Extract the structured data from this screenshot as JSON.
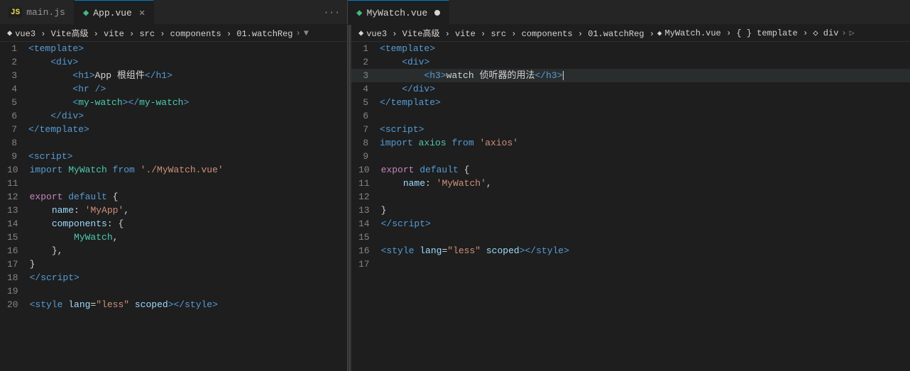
{
  "tabs_left": [
    {
      "id": "main-js",
      "icon": "JS",
      "icon_type": "js",
      "label": "main.js",
      "active": false,
      "modified": false,
      "closable": false
    },
    {
      "id": "app-vue",
      "icon": "V",
      "icon_type": "vue",
      "label": "App.vue",
      "active": true,
      "modified": false,
      "closable": true
    }
  ],
  "tabs_more_left": "···",
  "tabs_right": [
    {
      "id": "mywatch-vue",
      "icon": "V",
      "icon_type": "vue",
      "label": "MyWatch.vue",
      "active": true,
      "modified": true,
      "closable": false
    }
  ],
  "breadcrumb_left": {
    "items": [
      "vue3",
      "Vite高级",
      "vite",
      "src",
      "components",
      "01.watchReg"
    ],
    "icon": "▼"
  },
  "breadcrumb_right": {
    "items": [
      "vue3",
      "Vite高级",
      "vite",
      "src",
      "components",
      "01.watchReg"
    ],
    "file": "MyWatch.vue",
    "sections": [
      "{ } template",
      "◇ div"
    ]
  },
  "code_left": [
    {
      "num": 1,
      "tokens": [
        {
          "t": "<",
          "c": "tag"
        },
        {
          "t": "template",
          "c": "tag-name-html"
        },
        {
          "t": ">",
          "c": "tag"
        }
      ]
    },
    {
      "num": 2,
      "tokens": [
        {
          "t": "    ",
          "c": "plain"
        },
        {
          "t": "<",
          "c": "tag"
        },
        {
          "t": "div",
          "c": "tag-name-html"
        },
        {
          "t": ">",
          "c": "tag"
        }
      ]
    },
    {
      "num": 3,
      "tokens": [
        {
          "t": "        ",
          "c": "plain"
        },
        {
          "t": "<",
          "c": "tag"
        },
        {
          "t": "h1",
          "c": "tag-name-html"
        },
        {
          "t": ">",
          "c": "tag"
        },
        {
          "t": "App 根组件",
          "c": "plain"
        },
        {
          "t": "</",
          "c": "tag"
        },
        {
          "t": "h1",
          "c": "tag-name-html"
        },
        {
          "t": ">",
          "c": "tag"
        }
      ]
    },
    {
      "num": 4,
      "tokens": [
        {
          "t": "        ",
          "c": "plain"
        },
        {
          "t": "<",
          "c": "tag"
        },
        {
          "t": "hr",
          "c": "tag-name-html"
        },
        {
          "t": " />",
          "c": "tag"
        }
      ]
    },
    {
      "num": 5,
      "tokens": [
        {
          "t": "        ",
          "c": "plain"
        },
        {
          "t": "<",
          "c": "tag"
        },
        {
          "t": "my-watch",
          "c": "component"
        },
        {
          "t": "></",
          "c": "tag"
        },
        {
          "t": "my-watch",
          "c": "component"
        },
        {
          "t": ">",
          "c": "tag"
        }
      ]
    },
    {
      "num": 6,
      "tokens": [
        {
          "t": "    ",
          "c": "plain"
        },
        {
          "t": "</",
          "c": "tag"
        },
        {
          "t": "div",
          "c": "tag-name-html"
        },
        {
          "t": ">",
          "c": "tag"
        }
      ]
    },
    {
      "num": 7,
      "tokens": [
        {
          "t": "</",
          "c": "tag"
        },
        {
          "t": "template",
          "c": "tag-name-html"
        },
        {
          "t": ">",
          "c": "tag"
        }
      ]
    },
    {
      "num": 8,
      "tokens": []
    },
    {
      "num": 9,
      "tokens": [
        {
          "t": "<",
          "c": "tag"
        },
        {
          "t": "script",
          "c": "tag-name-html"
        },
        {
          "t": ">",
          "c": "tag"
        }
      ]
    },
    {
      "num": 10,
      "tokens": [
        {
          "t": "import ",
          "c": "keyword-blue"
        },
        {
          "t": "MyWatch ",
          "c": "component"
        },
        {
          "t": "from ",
          "c": "keyword-blue"
        },
        {
          "t": "'./MyWatch.vue'",
          "c": "string"
        }
      ]
    },
    {
      "num": 11,
      "tokens": []
    },
    {
      "num": 12,
      "tokens": [
        {
          "t": "export ",
          "c": "keyword"
        },
        {
          "t": "default ",
          "c": "keyword-blue"
        },
        {
          "t": "{",
          "c": "plain"
        }
      ]
    },
    {
      "num": 13,
      "tokens": [
        {
          "t": "    ",
          "c": "plain"
        },
        {
          "t": "name",
          "c": "blue-light"
        },
        {
          "t": ": ",
          "c": "plain"
        },
        {
          "t": "'MyApp'",
          "c": "string"
        },
        {
          "t": ",",
          "c": "plain"
        }
      ]
    },
    {
      "num": 14,
      "tokens": [
        {
          "t": "    ",
          "c": "plain"
        },
        {
          "t": "components",
          "c": "blue-light"
        },
        {
          "t": ": {",
          "c": "plain"
        }
      ]
    },
    {
      "num": 15,
      "tokens": [
        {
          "t": "        ",
          "c": "plain"
        },
        {
          "t": "MyWatch",
          "c": "component"
        },
        {
          "t": ",",
          "c": "plain"
        }
      ]
    },
    {
      "num": 16,
      "tokens": [
        {
          "t": "    ",
          "c": "plain"
        },
        {
          "t": "},",
          "c": "plain"
        }
      ]
    },
    {
      "num": 17,
      "tokens": [
        {
          "t": "}",
          "c": "plain"
        }
      ]
    },
    {
      "num": 18,
      "tokens": [
        {
          "t": "</",
          "c": "tag"
        },
        {
          "t": "script",
          "c": "tag-name-html"
        },
        {
          "t": ">",
          "c": "tag"
        }
      ]
    },
    {
      "num": 19,
      "tokens": []
    },
    {
      "num": 20,
      "tokens": [
        {
          "t": "<",
          "c": "tag"
        },
        {
          "t": "style ",
          "c": "tag-name-html"
        },
        {
          "t": "lang",
          "c": "attr-name"
        },
        {
          "t": "=",
          "c": "plain"
        },
        {
          "t": "\"less\"",
          "c": "attr-value"
        },
        {
          "t": " scoped",
          "c": "attr-name"
        },
        {
          "t": "></",
          "c": "tag"
        },
        {
          "t": "style",
          "c": "tag-name-html"
        },
        {
          "t": ">",
          "c": "tag"
        }
      ]
    }
  ],
  "code_right": [
    {
      "num": 1,
      "tokens": [
        {
          "t": "<",
          "c": "tag"
        },
        {
          "t": "template",
          "c": "tag-name-html"
        },
        {
          "t": ">",
          "c": "tag"
        }
      ]
    },
    {
      "num": 2,
      "tokens": [
        {
          "t": "    ",
          "c": "plain"
        },
        {
          "t": "<",
          "c": "tag"
        },
        {
          "t": "div",
          "c": "tag-name-html"
        },
        {
          "t": ">",
          "c": "tag"
        }
      ]
    },
    {
      "num": 3,
      "tokens": [
        {
          "t": "        ",
          "c": "plain"
        },
        {
          "t": "<",
          "c": "tag"
        },
        {
          "t": "h3",
          "c": "tag-name-html"
        },
        {
          "t": ">",
          "c": "tag"
        },
        {
          "t": "watch 侦听器的用法",
          "c": "plain"
        },
        {
          "t": "</",
          "c": "tag"
        },
        {
          "t": "h3",
          "c": "tag-name-html"
        },
        {
          "t": ">",
          "c": "tag"
        },
        {
          "t": "│",
          "c": "plain"
        }
      ],
      "cursor": true
    },
    {
      "num": 4,
      "tokens": [
        {
          "t": "    ",
          "c": "plain"
        },
        {
          "t": "</",
          "c": "tag"
        },
        {
          "t": "div",
          "c": "tag-name-html"
        },
        {
          "t": ">",
          "c": "tag"
        }
      ]
    },
    {
      "num": 5,
      "tokens": [
        {
          "t": "</",
          "c": "tag"
        },
        {
          "t": "template",
          "c": "tag-name-html"
        },
        {
          "t": ">",
          "c": "tag"
        }
      ]
    },
    {
      "num": 6,
      "tokens": []
    },
    {
      "num": 7,
      "tokens": [
        {
          "t": "<",
          "c": "tag"
        },
        {
          "t": "script",
          "c": "tag-name-html"
        },
        {
          "t": ">",
          "c": "tag"
        }
      ]
    },
    {
      "num": 8,
      "tokens": [
        {
          "t": "import ",
          "c": "keyword-blue"
        },
        {
          "t": "axios ",
          "c": "component"
        },
        {
          "t": "from ",
          "c": "keyword-blue"
        },
        {
          "t": "'axios'",
          "c": "string"
        }
      ]
    },
    {
      "num": 9,
      "tokens": []
    },
    {
      "num": 10,
      "tokens": [
        {
          "t": "export ",
          "c": "keyword"
        },
        {
          "t": "default ",
          "c": "keyword-blue"
        },
        {
          "t": "{",
          "c": "plain"
        }
      ]
    },
    {
      "num": 11,
      "tokens": [
        {
          "t": "    ",
          "c": "plain"
        },
        {
          "t": "name",
          "c": "blue-light"
        },
        {
          "t": ": ",
          "c": "plain"
        },
        {
          "t": "'MyWatch'",
          "c": "string"
        },
        {
          "t": ",",
          "c": "plain"
        }
      ]
    },
    {
      "num": 12,
      "tokens": []
    },
    {
      "num": 13,
      "tokens": [
        {
          "t": "}",
          "c": "plain"
        }
      ]
    },
    {
      "num": 14,
      "tokens": [
        {
          "t": "</",
          "c": "tag"
        },
        {
          "t": "script",
          "c": "tag-name-html"
        },
        {
          "t": ">",
          "c": "tag"
        }
      ]
    },
    {
      "num": 15,
      "tokens": []
    },
    {
      "num": 16,
      "tokens": [
        {
          "t": "<",
          "c": "tag"
        },
        {
          "t": "style ",
          "c": "tag-name-html"
        },
        {
          "t": "lang",
          "c": "attr-name"
        },
        {
          "t": "=",
          "c": "plain"
        },
        {
          "t": "\"less\"",
          "c": "attr-value"
        },
        {
          "t": " scoped",
          "c": "attr-name"
        },
        {
          "t": "></",
          "c": "tag"
        },
        {
          "t": "style",
          "c": "tag-name-html"
        },
        {
          "t": ">",
          "c": "tag"
        }
      ]
    },
    {
      "num": 17,
      "tokens": []
    }
  ],
  "colors": {
    "bg": "#1e1e1e",
    "tab_active_border": "#007acc",
    "tab_bar_bg": "#252526",
    "vue_green": "#42b883"
  }
}
